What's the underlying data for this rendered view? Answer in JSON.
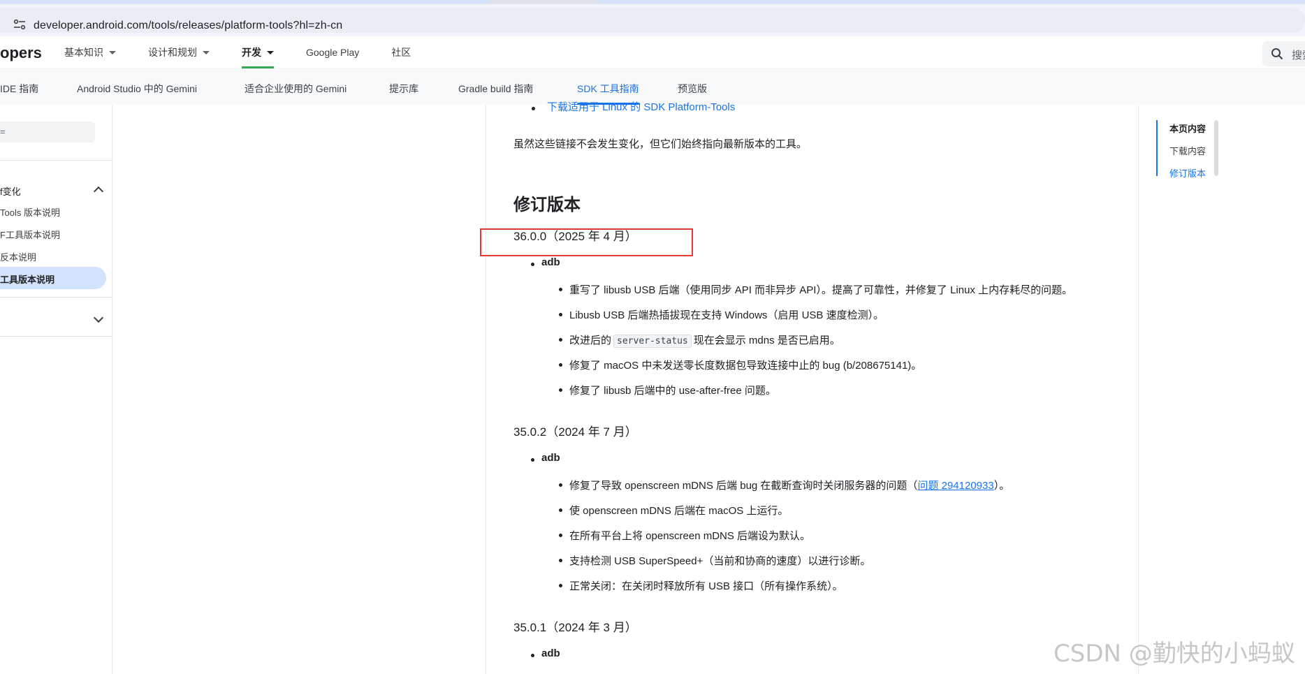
{
  "browser": {
    "url": "developer.android.com/tools/releases/platform-tools?hl=zh-cn"
  },
  "topnav": {
    "brand": "opers",
    "items": [
      {
        "label": "基本知识",
        "dropdown": true
      },
      {
        "label": "设计和规划",
        "dropdown": true
      },
      {
        "label": "开发",
        "dropdown": true,
        "active": true
      },
      {
        "label": "Google Play"
      },
      {
        "label": "社区"
      }
    ],
    "search_placeholder": "搜索"
  },
  "subnav": {
    "items": [
      "IDE 指南",
      "Android Studio 中的 Gemini",
      "适合企业使用的 Gemini",
      "提示库",
      "Gradle build 指南",
      "SDK 工具指南",
      "预览版"
    ],
    "active": "SDK 工具指南"
  },
  "sidebar": {
    "filter_label": "=",
    "section_title": "f变化",
    "links": [
      "Tools 版本说明",
      "F工具版本说明",
      "反本说明",
      "工具版本说明"
    ],
    "active_link": "工具版本说明"
  },
  "article": {
    "top_link": "下载适用于 Linux 的 SDK Platform-Tools",
    "intro": "虽然这些链接不会发生变化，但它们始终指向最新版本的工具。",
    "heading": "修订版本",
    "releases": [
      {
        "version": "36.0.0（2025 年 4 月）",
        "component": "adb",
        "items": [
          {
            "text": "重写了 libusb USB 后端（使用同步 API 而非异步 API）。提高了可靠性，并修复了 Linux 上内存耗尽的问题。"
          },
          {
            "text": "Libusb USB 后端热插拔现在支持 Windows（启用 USB 速度检测）。"
          },
          {
            "pre": "改进后的",
            "code": "server-status",
            "post": "现在会显示 mdns 是否已启用。"
          },
          {
            "text": "修复了 macOS 中未发送零长度数据包导致连接中止的 bug (b/208675141)。"
          },
          {
            "text": "修复了 libusb 后端中的 use-after-free 问题。"
          }
        ]
      },
      {
        "version": "35.0.2（2024 年 7 月）",
        "component": "adb",
        "items": [
          {
            "pre": "修复了导致 openscreen mDNS 后端 bug 在截断查询时关闭服务器的问题（",
            "link": "问题 294120933",
            "post": "）。"
          },
          {
            "text": "使 openscreen mDNS 后端在 macOS 上运行。"
          },
          {
            "text": "在所有平台上将 openscreen mDNS 后端设为默认。"
          },
          {
            "text": "支持检测 USB SuperSpeed+（当前和协商的速度）以进行诊断。"
          },
          {
            "text": "正常关闭：在关闭时释放所有 USB 接口（所有操作系统）。"
          }
        ]
      },
      {
        "version": "35.0.1（2024 年 3 月）",
        "component": "adb"
      }
    ]
  },
  "toc": {
    "items": [
      "本页内容",
      "下载内容",
      "修订版本"
    ],
    "current": "修订版本"
  },
  "watermark": "CSDN @勤快的小蚂蚁",
  "colors": {
    "accent": "#1a73e8",
    "highlight_box": "#e53935",
    "active_green": "#34a853"
  }
}
